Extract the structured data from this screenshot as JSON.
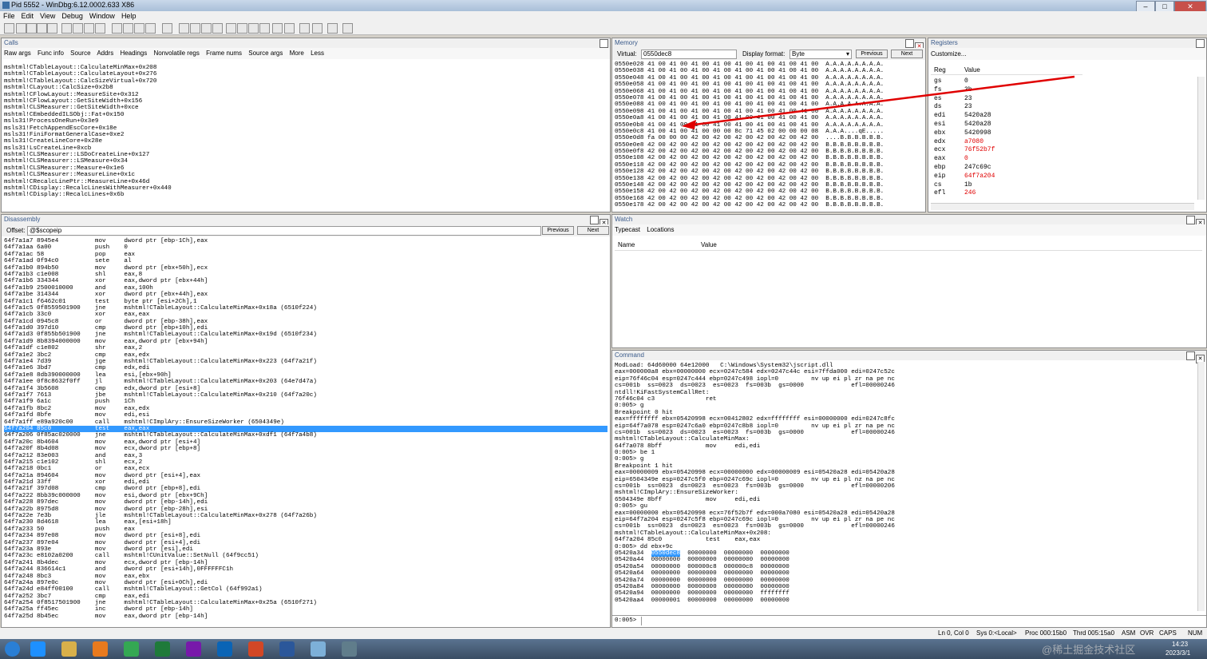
{
  "window": {
    "title": "Pid 5552 - WinDbg:6.12.0002.633 X86"
  },
  "menu": [
    "File",
    "Edit",
    "View",
    "Debug",
    "Window",
    "Help"
  ],
  "calls": {
    "title": "Calls",
    "tabs": [
      "Raw args",
      "Func info",
      "Source",
      "Addrs",
      "Headings",
      "Nonvolatile regs",
      "Frame nums",
      "Source args",
      "More",
      "Less"
    ],
    "lines": [
      "mshtml!CTableLayout::CalculateMinMax+0x208",
      "mshtml!CTableLayout::CalculateLayout+0x276",
      "mshtml!CTableLayout::CalcSizeVirtual+0x720",
      "mshtml!CLayout::CalcSize+0x2b8",
      "mshtml!CFlowLayout::MeasureSite+0x312",
      "mshtml!CFlowLayout::GetSiteWidth+0x156",
      "mshtml!CLSMeasurer::GetSiteWidth+0xce",
      "mshtml!CEmbeddedILSObj::Fat+0x150",
      "msls31!ProcessOneRun+0x3e9",
      "msls31!FetchAppendEscCore+0x18e",
      "msls31!FiniFormatGeneralCase+0xe2",
      "msls31!CreateLineCore+0x28e",
      "msls31!LsCreateLine+0xcb",
      "mshtml!CLSMeasurer::LSDoCreateLine+0x127",
      "mshtml!CLSMeasurer::LSMeasure+0x34",
      "mshtml!CLSMeasurer::Measure+0x1e6",
      "mshtml!CLSMeasurer::MeasureLine+0x1c",
      "mshtml!CRecalcLinePtr::MeasureLine+0x46d",
      "mshtml!CDisplay::RecalcLinesWithMeasurer+0x440",
      "mshtml!CDisplay::RecalcLines+0x6b"
    ]
  },
  "memory": {
    "title": "Memory",
    "virtual_label": "Virtual:",
    "virtual_value": "0550dec8",
    "format_label": "Display format:",
    "format_value": "Byte",
    "prev_label": "Previous",
    "next_label": "Next",
    "lines": [
      "0550e028 41 00 41 00 41 00 41 00 41 00 41 00 41 00 41 00  A.A.A.A.A.A.A.A.",
      "0550e038 41 00 41 00 41 00 41 00 41 00 41 00 41 00 41 00  A.A.A.A.A.A.A.A.",
      "0550e048 41 00 41 00 41 00 41 00 41 00 41 00 41 00 41 00  A.A.A.A.A.A.A.A.",
      "0550e058 41 00 41 00 41 00 41 00 41 00 41 00 41 00 41 00  A.A.A.A.A.A.A.A.",
      "0550e068 41 00 41 00 41 00 41 00 41 00 41 00 41 00 41 00  A.A.A.A.A.A.A.A.",
      "0550e078 41 00 41 00 41 00 41 00 41 00 41 00 41 00 41 00  A.A.A.A.A.A.A.A.",
      "0550e088 41 00 41 00 41 00 41 00 41 00 41 00 41 00 41 00  A.A.A.A.A.A.A.A.",
      "0550e098 41 00 41 00 41 00 41 00 41 00 41 00 41 00 41 00  A.A.A.A.A.A.A.A.",
      "0550e0a8 41 00 41 00 41 00 41 00 41 00 41 00 41 00 41 00  A.A.A.A.A.A.A.A.",
      "0550e0b8 41 00 41 00 41 00 41 00 41 00 41 00 41 00 41 00  A.A.A.A.A.A.A.A.",
      "0550e0c8 41 00 41 00 41 00 00 00 8c 71 45 02 00 00 00 08  A.A.A....qE.....",
      "0550e0d8 fa 00 00 00 42 00 42 00 42 00 42 00 42 00 42 00  ....B.B.B.B.B.B.",
      "0550e0e8 42 00 42 00 42 00 42 00 42 00 42 00 42 00 42 00  B.B.B.B.B.B.B.B.",
      "0550e0f8 42 00 42 00 42 00 42 00 42 00 42 00 42 00 42 00  B.B.B.B.B.B.B.B.",
      "0550e108 42 00 42 00 42 00 42 00 42 00 42 00 42 00 42 00  B.B.B.B.B.B.B.B.",
      "0550e118 42 00 42 00 42 00 42 00 42 00 42 00 42 00 42 00  B.B.B.B.B.B.B.B.",
      "0550e128 42 00 42 00 42 00 42 00 42 00 42 00 42 00 42 00  B.B.B.B.B.B.B.B.",
      "0550e138 42 00 42 00 42 00 42 00 42 00 42 00 42 00 42 00  B.B.B.B.B.B.B.B.",
      "0550e148 42 00 42 00 42 00 42 00 42 00 42 00 42 00 42 00  B.B.B.B.B.B.B.B.",
      "0550e158 42 00 42 00 42 00 42 00 42 00 42 00 42 00 42 00  B.B.B.B.B.B.B.B.",
      "0550e168 42 00 42 00 42 00 42 00 42 00 42 00 42 00 42 00  B.B.B.B.B.B.B.B.",
      "0550e178 42 00 42 00 42 00 42 00 42 00 42 00 42 00 42 00  B.B.B.B.B.B.B.B."
    ]
  },
  "registers": {
    "title": "Registers",
    "customize_label": "Customize...",
    "header_reg": "Reg",
    "header_value": "Value",
    "rows": [
      {
        "reg": "gs",
        "value": "0",
        "changed": false
      },
      {
        "reg": "fs",
        "value": "3b",
        "changed": false
      },
      {
        "reg": "es",
        "value": "23",
        "changed": false
      },
      {
        "reg": "ds",
        "value": "23",
        "changed": false
      },
      {
        "reg": "edi",
        "value": "5420a28",
        "changed": false
      },
      {
        "reg": "esi",
        "value": "5420a28",
        "changed": false
      },
      {
        "reg": "ebx",
        "value": "5420998",
        "changed": false
      },
      {
        "reg": "edx",
        "value": "a7080",
        "changed": true
      },
      {
        "reg": "ecx",
        "value": "76f52b7f",
        "changed": true
      },
      {
        "reg": "eax",
        "value": "0",
        "changed": true
      },
      {
        "reg": "ebp",
        "value": "247c69c",
        "changed": false
      },
      {
        "reg": "eip",
        "value": "64f7a204",
        "changed": true
      },
      {
        "reg": "cs",
        "value": "1b",
        "changed": false
      },
      {
        "reg": "efl",
        "value": "246",
        "changed": true
      }
    ],
    "changed_color": "#e00000"
  },
  "disassembly": {
    "title": "Disassembly",
    "offset_label": "Offset:",
    "offset_value": "@$scopeip",
    "prev_label": "Previous",
    "next_label": "Next",
    "selected_index": 28,
    "lines": [
      "64f7a1a7 8945e4          mov     dword ptr [ebp-1Ch],eax",
      "64f7a1aa 6a00            push    0",
      "64f7a1ac 58              pop     eax",
      "64f7a1ad 0f94c0          sete    al",
      "64f7a1b0 894b50          mov     dword ptr [ebx+50h],ecx",
      "64f7a1b3 c1e008          shl     eax,8",
      "64f7a1b6 334344          xor     eax,dword ptr [ebx+44h]",
      "64f7a1b9 2500010000      and     eax,100h",
      "64f7a1be 314344          xor     dword ptr [ebx+44h],eax",
      "64f7a1c1 f6462c01        test    byte ptr [esi+2Ch],1",
      "64f7a1c5 0f8559501900    jne     mshtml!CTableLayout::CalculateMinMax+0x18a (6510f224)",
      "64f7a1cb 33c0            xor     eax,eax",
      "64f7a1cd 0945c8          or      dword ptr [ebp-38h],eax",
      "64f7a1d0 397d10          cmp     dword ptr [ebp+10h],edi",
      "64f7a1d3 0f855b501900    jne     mshtml!CTableLayout::CalculateMinMax+0x19d (6510f234)",
      "64f7a1d9 8b8394000000    mov     eax,dword ptr [ebx+94h]",
      "64f7a1df c1e802          shr     eax,2",
      "64f7a1e2 3bc2            cmp     eax,edx",
      "64f7a1e4 7d39            jge     mshtml!CTableLayout::CalculateMinMax+0x223 (64f7a21f)",
      "64f7a1e6 3bd7            cmp     edx,edi",
      "64f7a1e8 8db390000000    lea     esi,[ebx+90h]",
      "64f7a1ee 0f8c8632f0ff    jl      mshtml!CTableLayout::CalculateMinMax+0x203 (64e7d47a)",
      "64f7a1f4 3b5608          cmp     edx,dword ptr [esi+8]",
      "64f7a1f7 7613            jbe     mshtml!CTableLayout::CalculateMinMax+0x210 (64f7a20c)",
      "64f7a1f9 6a1c            push    1Ch",
      "64f7a1fb 8bc2            mov     eax,edx",
      "64f7a1fd 8bfe            mov     edi,esi",
      "64f7a1ff e89a920c00      call    mshtml!CImplAry::EnsureSizeWorker (6504349e)",
      "64f7a204 85c0            test    eax,eax",
      "64f7a206 0f85ac020000    jne     mshtml!CTableLayout::CalculateMinMax+0xdf1 (64f7a4b8)",
      "64f7a20c 8b4604          mov     eax,dword ptr [esi+4]",
      "64f7a20f 8b4d08          mov     ecx,dword ptr [ebp+8]",
      "64f7a212 83e003          and     eax,3",
      "64f7a215 c1e102          shl     ecx,2",
      "64f7a218 0bc1            or      eax,ecx",
      "64f7a21a 894604          mov     dword ptr [esi+4],eax",
      "64f7a21d 33ff            xor     edi,edi",
      "64f7a21f 397d08          cmp     dword ptr [ebp+8],edi",
      "64f7a222 8bb39c000000    mov     esi,dword ptr [ebx+9Ch]",
      "64f7a228 897dec          mov     dword ptr [ebp-14h],edi",
      "64f7a22b 8975d8          mov     dword ptr [ebp-28h],esi",
      "64f7a22e 7e3b            jle     mshtml!CTableLayout::CalculateMinMax+0x278 (64f7a26b)",
      "64f7a230 8d4618          lea     eax,[esi+18h]",
      "64f7a233 50              push    eax",
      "64f7a234 897e08          mov     dword ptr [esi+8],edi",
      "64f7a237 897e04          mov     dword ptr [esi+4],edi",
      "64f7a23a 893e            mov     dword ptr [esi],edi",
      "64f7a23c e8102a0200      call    mshtml!CUnitValue::SetNull (64f9cc51)",
      "64f7a241 8b4dec          mov     ecx,dword ptr [ebp-14h]",
      "64f7a244 836614c1        and     dword ptr [esi+14h],0FFFFFFC1h",
      "64f7a248 8bc3            mov     eax,ebx",
      "64f7a24a 897e0c          mov     dword ptr [esi+0Ch],edi",
      "64f7a24d e84ff00100      call    mshtml!CTableLayout::GetCol (64f992a1)",
      "64f7a252 3bc7            cmp     eax,edi",
      "64f7a254 0f8517501900    jne     mshtml!CTableLayout::CalculateMinMax+0x25a (6510f271)",
      "64f7a25a ff45ec          inc     dword ptr [ebp-14h]",
      "64f7a25d 8b45ec          mov     eax,dword ptr [ebp-14h]"
    ]
  },
  "watch": {
    "title": "Watch",
    "tabs": [
      "Typecast",
      "Locations"
    ],
    "col_name": "Name",
    "col_value": "Value"
  },
  "command": {
    "title": "Command",
    "prompt": "0:005>",
    "lines": [
      "ModLoad: 64d60000 64e12000   C:\\Windows\\System32\\jscript.dll",
      "eax=000000a8 ebx=00000000 ecx=0247c584 edx=0247c44c esi=7ffda000 edi=0247c52c",
      "eip=76f46c04 esp=0247c444 ebp=0247c498 iopl=0         nv up ei pl zr na pe nc",
      "cs=001b  ss=0023  ds=0023  es=0023  fs=003b  gs=0000             efl=00000246",
      "ntdll!KiFastSystemCallRet:",
      "76f46c04 c3              ret",
      "0:005> g",
      "Breakpoint 0 hit",
      "eax=ffffffff ebx=05420998 ecx=00412802 edx=ffffffff esi=00000000 edi=0247c8fc",
      "eip=64f7a078 esp=0247c6a0 ebp=0247c8b8 iopl=0         nv up ei pl zr na pe nc",
      "cs=001b  ss=0023  ds=0023  es=0023  fs=003b  gs=0000             efl=00000246",
      "mshtml!CTableLayout::CalculateMinMax:",
      "64f7a078 8bff            mov     edi,edi",
      "0:005> be 1",
      "0:005> g",
      "Breakpoint 1 hit",
      "eax=00000009 ebx=05420998 ecx=00000000 edx=00000009 esi=05420a28 edi=05420a28",
      "eip=6504349e esp=0247c5f0 ebp=0247c69c iopl=0         nv up ei pl nz na pe nc",
      "cs=001b  ss=0023  ds=0023  es=0023  fs=003b  gs=0000             efl=00000206",
      "mshtml!CImplAry::EnsureSizeWorker:",
      "6504349e 8bff            mov     edi,edi",
      "0:005> gu",
      "eax=00000000 ebx=05420998 ecx=76f52b7f edx=000a7080 esi=05420a28 edi=05420a28",
      "eip=64f7a204 esp=0247c5f8 ebp=0247c69c iopl=0         nv up ei pl zr na pe nc",
      "cs=001b  ss=0023  ds=0023  es=0023  fs=003b  gs=0000             efl=00000246",
      "mshtml!CTableLayout::CalculateMinMax+0x208:",
      "64f7a204 85c0            test    eax,eax",
      "0:005> dd ebx+9c"
    ],
    "dump_rows": [
      {
        "addr": "05420a34",
        "vals": [
          "0550dec8",
          "00000000",
          "00000000",
          "00000000"
        ]
      },
      {
        "addr": "05420a44",
        "vals": [
          "00000000",
          "00000000",
          "00000000",
          "00000000"
        ]
      },
      {
        "addr": "05420a54",
        "vals": [
          "00000000",
          "000000c8",
          "000000c8",
          "00000000"
        ]
      },
      {
        "addr": "05420a64",
        "vals": [
          "00000000",
          "00000000",
          "00000000",
          "00000000"
        ]
      },
      {
        "addr": "05420a74",
        "vals": [
          "00000000",
          "00000000",
          "00000000",
          "00000000"
        ]
      },
      {
        "addr": "05420a84",
        "vals": [
          "00000000",
          "00000000",
          "00000000",
          "00000000"
        ]
      },
      {
        "addr": "05420a94",
        "vals": [
          "00000000",
          "00000000",
          "00000000",
          "ffffffff"
        ]
      },
      {
        "addr": "05420aa4",
        "vals": [
          "00000001",
          "00000000",
          "00000000",
          "00000000"
        ]
      }
    ]
  },
  "statusbar": {
    "items": [
      "Ln 0, Col 0",
      "Sys 0:<Local>",
      "Proc 000:15b0",
      "Thrd 005:15a0",
      "ASM",
      "OVR",
      "CAPS",
      "NUM"
    ]
  },
  "taskbar": {
    "time": "14:23",
    "date": "2023/3/1",
    "icons": [
      "start-orb-icon",
      "ie-icon",
      "explorer-icon",
      "media-player-icon",
      "chrome-icon",
      "excel-icon",
      "onenote-icon",
      "outlook-icon",
      "powerpoint-icon",
      "word-icon",
      "notepad-icon",
      "windbg-icon"
    ],
    "icon_colors": [
      "#2a7fd6",
      "#1e90ff",
      "#d8b04a",
      "#e87a1e",
      "#34a853",
      "#1f7a3a",
      "#7719aa",
      "#0a64b6",
      "#d24726",
      "#2b579a",
      "#7db0d8",
      "#607d8b"
    ],
    "watermark": "@稀土掘金技术社区"
  },
  "annotation": {
    "color": "#e00000"
  }
}
